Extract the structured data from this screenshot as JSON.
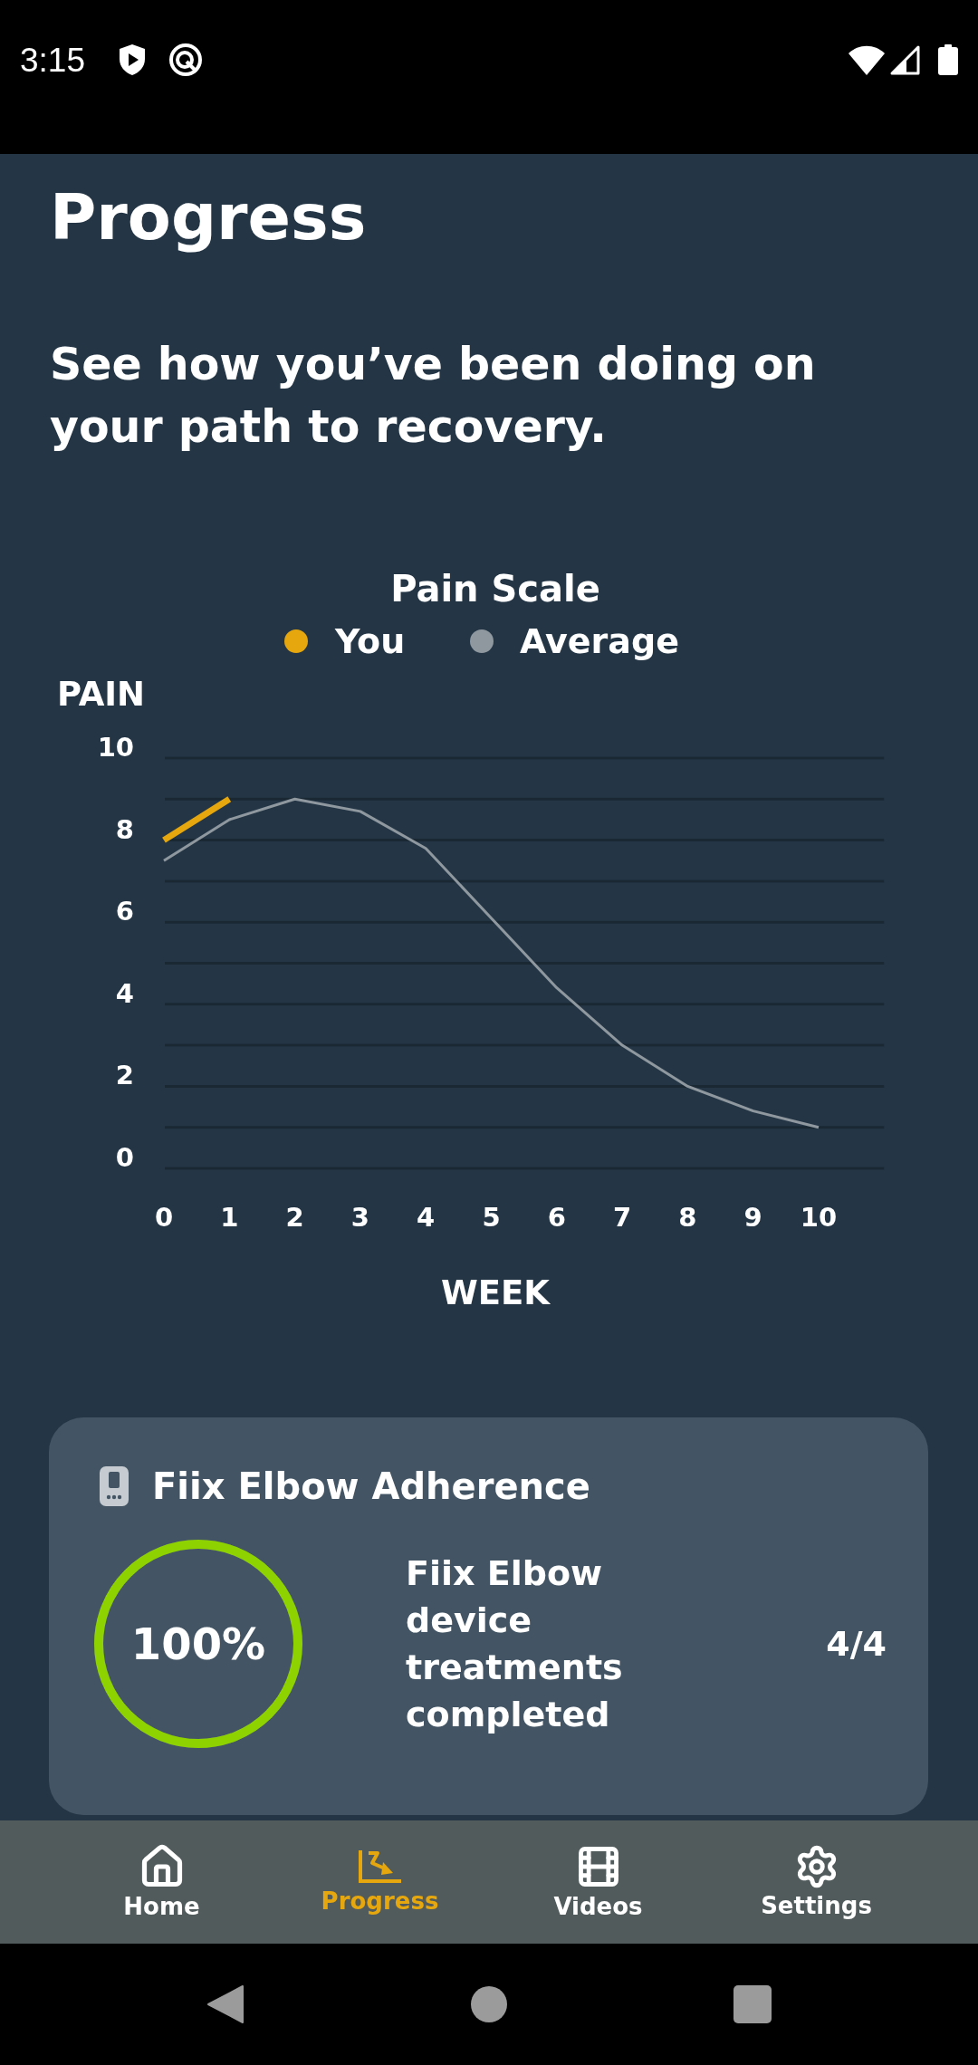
{
  "status_bar": {
    "time": "3:15"
  },
  "header": {
    "title": "Progress",
    "subtitle": "See how you’ve been doing on your path to recovery."
  },
  "pain_chart": {
    "chart_data": {
      "type": "line",
      "title": "Pain Scale",
      "xlabel": "WEEK",
      "ylabel": "PAIN",
      "x": [
        0,
        1,
        2,
        3,
        4,
        5,
        6,
        7,
        8,
        9,
        10
      ],
      "series": [
        {
          "name": "You",
          "color": "#e6a70e",
          "values": [
            8,
            9,
            null,
            null,
            null,
            null,
            null,
            null,
            null,
            null,
            null
          ]
        },
        {
          "name": "Average",
          "color": "#8f989f",
          "values": [
            7.5,
            8.5,
            9,
            8.7,
            7.8,
            6.1,
            4.4,
            3,
            2,
            1.4,
            1
          ]
        }
      ],
      "xlim": [
        0,
        11
      ],
      "ylim": [
        0,
        10
      ],
      "xticks": [
        0,
        1,
        2,
        3,
        4,
        5,
        6,
        7,
        8,
        9,
        10
      ],
      "yticks": [
        0,
        2,
        4,
        6,
        8,
        10
      ],
      "grid": true,
      "legend": "top"
    }
  },
  "adherence_card": {
    "title": "Fiix Elbow Adherence",
    "percent": "100%",
    "level": 1,
    "description": "Fiix Elbow device treatments completed",
    "count": "4/4"
  },
  "bottom_nav": [
    {
      "label": "Home",
      "selected": false
    },
    {
      "label": "Progress",
      "selected": true
    },
    {
      "label": "Videos",
      "selected": false
    },
    {
      "label": "Settings",
      "selected": false
    }
  ]
}
